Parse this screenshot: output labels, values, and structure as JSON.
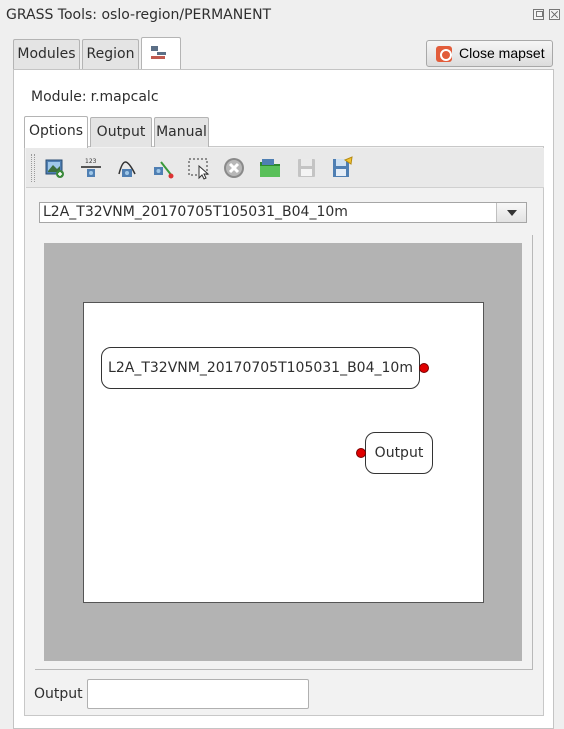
{
  "window": {
    "title": "GRASS Tools: oslo-region/PERMANENT"
  },
  "top_tabs": [
    {
      "label": "Modules"
    },
    {
      "label": "Region"
    },
    {
      "icon": "model-icon"
    }
  ],
  "close_mapset": {
    "label": "Close mapset",
    "icon": "close-mapset-icon"
  },
  "module": {
    "prefix": "Module:",
    "name": "r.mapcalc"
  },
  "sub_tabs": [
    {
      "label": "Options",
      "active": true
    },
    {
      "label": "Output"
    },
    {
      "label": "Manual"
    }
  ],
  "toolbar": {
    "icons": [
      "add-raster-icon",
      "add-constant-icon",
      "add-function-icon",
      "add-relation-icon",
      "select-icon",
      "remove-icon",
      "open-icon",
      "save-icon",
      "save-as-icon"
    ]
  },
  "map_select": {
    "value": "L2A_T32VNM_20170705T105031_B04_10m"
  },
  "canvas": {
    "nodes": [
      {
        "label": "L2A_T32VNM_20170705T105031_B04_10m",
        "kind": "input"
      },
      {
        "label": "Output",
        "kind": "output"
      }
    ],
    "colors": {
      "port": "#e00000",
      "outer": "#b3b3b3",
      "inner": "#ffffff"
    }
  },
  "output": {
    "label": "Output",
    "value": ""
  }
}
